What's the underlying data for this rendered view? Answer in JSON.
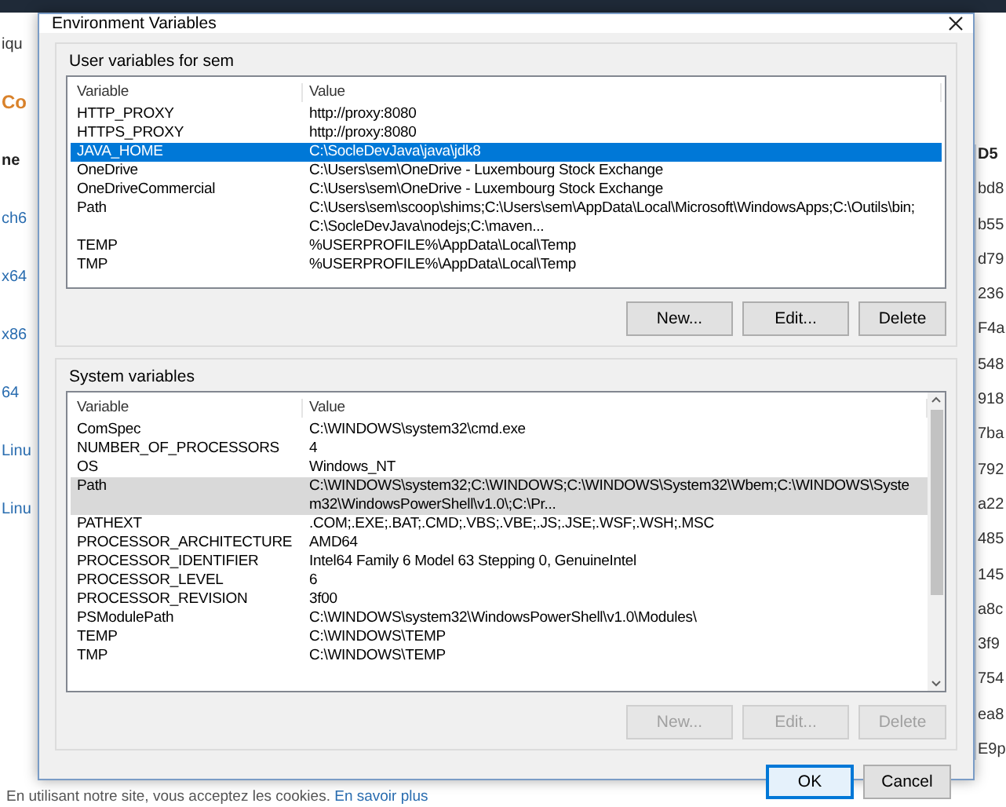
{
  "background": {
    "left_fragments": [
      {
        "text": "iqu",
        "kind": "text"
      },
      {
        "text": "Co",
        "kind": "heading"
      },
      {
        "text": "ne",
        "kind": "header"
      },
      {
        "text": "ch6",
        "kind": "link"
      },
      {
        "text": "x64",
        "kind": "link"
      },
      {
        "text": "x86",
        "kind": "link"
      },
      {
        "text": "64",
        "kind": "link"
      },
      {
        "text": "Linu",
        "kind": "link"
      },
      {
        "text": "Linu",
        "kind": "link"
      }
    ],
    "right_fragments": [
      {
        "text": "D5",
        "kind": "header"
      },
      {
        "text": "bd8",
        "kind": "text"
      },
      {
        "text": "b55",
        "kind": "text"
      },
      {
        "text": "d79",
        "kind": "text"
      },
      {
        "text": "236",
        "kind": "text"
      },
      {
        "text": "F4a",
        "kind": "text"
      },
      {
        "text": "548",
        "kind": "text"
      },
      {
        "text": "918",
        "kind": "text"
      },
      {
        "text": "7ba",
        "kind": "text"
      },
      {
        "text": "792",
        "kind": "text"
      },
      {
        "text": "a22",
        "kind": "text"
      },
      {
        "text": "485",
        "kind": "text"
      },
      {
        "text": "145",
        "kind": "text"
      },
      {
        "text": "a8c",
        "kind": "text"
      },
      {
        "text": "3f9",
        "kind": "text"
      },
      {
        "text": "754",
        "kind": "text"
      },
      {
        "text": "ea8",
        "kind": "text"
      },
      {
        "text": "E9p",
        "kind": "text"
      }
    ],
    "cookie_text": "En utilisant notre site, vous acceptez les cookies.",
    "cookie_link": "En savoir plus"
  },
  "dialog": {
    "title": "Environment Variables",
    "user_variables": {
      "label": "User variables for sem",
      "focused": true,
      "columns": [
        "Variable",
        "Value"
      ],
      "rows": [
        {
          "name": "HTTP_PROXY",
          "value": "http://proxy:8080",
          "selected": false
        },
        {
          "name": "HTTPS_PROXY",
          "value": "http://proxy:8080",
          "selected": false
        },
        {
          "name": "JAVA_HOME",
          "value": "C:\\SocleDevJava\\java\\jdk8",
          "selected": true
        },
        {
          "name": "OneDrive",
          "value": "C:\\Users\\sem\\OneDrive - Luxembourg Stock Exchange",
          "selected": false
        },
        {
          "name": "OneDriveCommercial",
          "value": "C:\\Users\\sem\\OneDrive - Luxembourg Stock Exchange",
          "selected": false
        },
        {
          "name": "Path",
          "value": "C:\\Users\\sem\\scoop\\shims;C:\\Users\\sem\\AppData\\Local\\Microsoft\\WindowsApps;C:\\Outils\\bin;C:\\SocleDevJava\\nodejs;C:\\maven...",
          "selected": false
        },
        {
          "name": "TEMP",
          "value": "%USERPROFILE%\\AppData\\Local\\Temp",
          "selected": false
        },
        {
          "name": "TMP",
          "value": "%USERPROFILE%\\AppData\\Local\\Temp",
          "selected": false
        }
      ],
      "buttons": [
        {
          "label": "New...",
          "disabled": false
        },
        {
          "label": "Edit...",
          "disabled": false
        },
        {
          "label": "Delete",
          "disabled": false
        }
      ]
    },
    "system_variables": {
      "label": "System variables",
      "focused": false,
      "columns": [
        "Variable",
        "Value"
      ],
      "rows": [
        {
          "name": "ComSpec",
          "value": "C:\\WINDOWS\\system32\\cmd.exe",
          "selected": false
        },
        {
          "name": "NUMBER_OF_PROCESSORS",
          "value": "4",
          "selected": false
        },
        {
          "name": "OS",
          "value": "Windows_NT",
          "selected": false
        },
        {
          "name": "Path",
          "value": "C:\\WINDOWS\\system32;C:\\WINDOWS;C:\\WINDOWS\\System32\\Wbem;C:\\WINDOWS\\System32\\WindowsPowerShell\\v1.0\\;C:\\Pr...",
          "selected": true
        },
        {
          "name": "PATHEXT",
          "value": ".COM;.EXE;.BAT;.CMD;.VBS;.VBE;.JS;.JSE;.WSF;.WSH;.MSC",
          "selected": false
        },
        {
          "name": "PROCESSOR_ARCHITECTURE",
          "value": "AMD64",
          "selected": false
        },
        {
          "name": "PROCESSOR_IDENTIFIER",
          "value": "Intel64 Family 6 Model 63 Stepping 0, GenuineIntel",
          "selected": false
        },
        {
          "name": "PROCESSOR_LEVEL",
          "value": "6",
          "selected": false
        },
        {
          "name": "PROCESSOR_REVISION",
          "value": "3f00",
          "selected": false
        },
        {
          "name": "PSModulePath",
          "value": "C:\\WINDOWS\\system32\\WindowsPowerShell\\v1.0\\Modules\\",
          "selected": false
        },
        {
          "name": "TEMP",
          "value": "C:\\WINDOWS\\TEMP",
          "selected": false
        },
        {
          "name": "TMP",
          "value": "C:\\WINDOWS\\TEMP",
          "selected": false
        }
      ],
      "buttons": [
        {
          "label": "New...",
          "disabled": true
        },
        {
          "label": "Edit...",
          "disabled": true
        },
        {
          "label": "Delete",
          "disabled": true
        }
      ]
    },
    "buttons": [
      {
        "label": "OK",
        "default": true
      },
      {
        "label": "Cancel",
        "default": false
      }
    ]
  }
}
